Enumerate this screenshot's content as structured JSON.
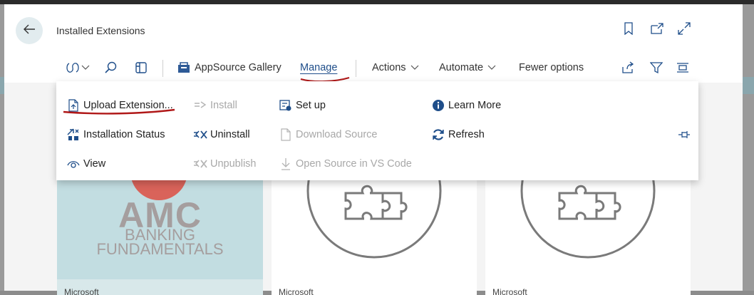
{
  "header": {
    "title": "Installed Extensions",
    "back_icon": "back-arrow-icon",
    "bookmark_icon": "bookmark-icon",
    "open_new_icon": "open-in-new-window-icon",
    "expand_icon": "expand-icon"
  },
  "toolbar": {
    "items": {
      "appsource": "AppSource Gallery",
      "manage": "Manage",
      "actions": "Actions",
      "automate": "Automate",
      "fewer": "Fewer options"
    }
  },
  "menu": {
    "upload": "Upload Extension...",
    "install": "Install",
    "setup": "Set up",
    "learn_more": "Learn More",
    "installation_status": "Installation Status",
    "uninstall": "Uninstall",
    "download_source": "Download Source",
    "refresh": "Refresh",
    "view": "View",
    "unpublish": "Unpublish",
    "open_source": "Open Source in VS Code"
  },
  "tiles": [
    {
      "logo_title": "AMC",
      "logo_line1": "BANKING",
      "logo_line2": "FUNDAMENTALS",
      "publisher": "Microsoft"
    },
    {
      "publisher": "Microsoft"
    },
    {
      "publisher": "Microsoft"
    }
  ],
  "colors": {
    "annotation_red": "#b01818",
    "info_blue": "#1f4e8a",
    "accent_teal": "#e2ecef"
  }
}
